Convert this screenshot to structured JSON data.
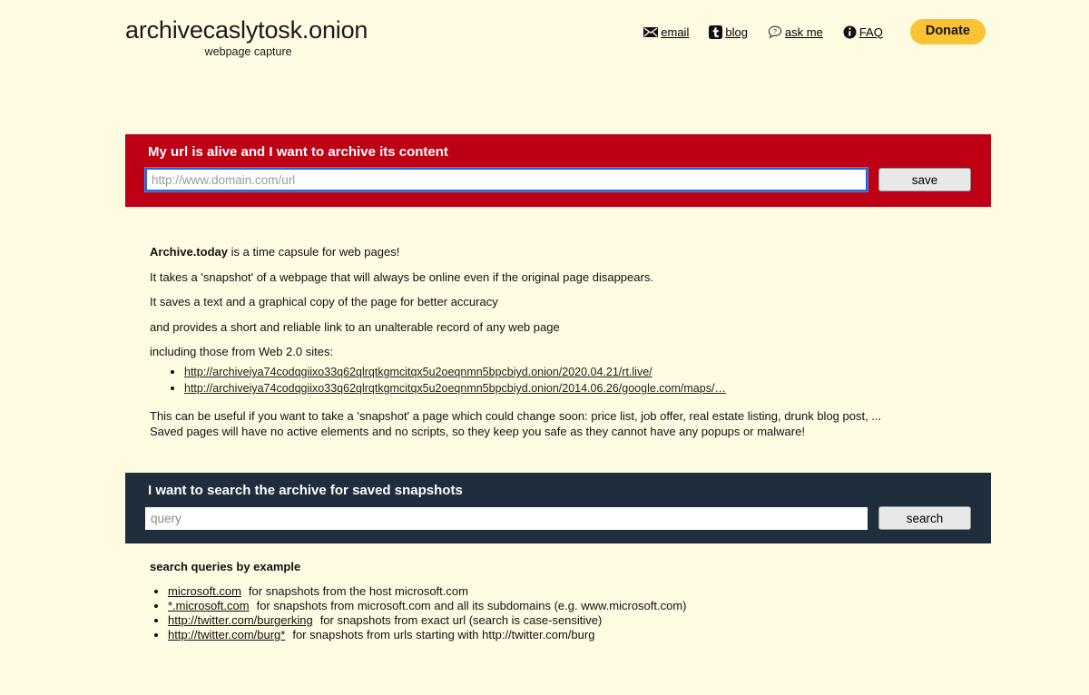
{
  "header": {
    "title": "archivecaslytosk.onion",
    "subtitle": "webpage capture",
    "nav": [
      {
        "id": "email",
        "label": "email",
        "icon": "envelope-icon"
      },
      {
        "id": "blog",
        "label": "blog",
        "icon": "tumblr-icon"
      },
      {
        "id": "ask-me",
        "label": "ask me",
        "icon": "question-bubble-icon"
      },
      {
        "id": "faq",
        "label": "FAQ",
        "icon": "info-circle-icon"
      }
    ],
    "donate_label": "Donate"
  },
  "archive_panel": {
    "title": "My url is alive and I want to archive its content",
    "input_placeholder": "http://www.domain.com/url",
    "input_value": "",
    "button_label": "save",
    "background": "#BE0015"
  },
  "intro": {
    "brand": "Archive.today",
    "line1_rest": " is a time capsule for web pages!",
    "line2": "It takes a 'snapshot' of a webpage that will always be online even if the original page disappears.",
    "line3": "It saves a text and a graphical copy of the page for better accuracy",
    "line4": "and provides a short and reliable link to an unalterable record of any web page",
    "line5": "including those from Web 2.0 sites:",
    "examples": [
      "http://archiveiya74codqgiixo33q62qlrqtkgmcitqx5u2oeqnmn5bpcbiyd.onion/2020.04.21/rt.live/",
      "http://archiveiya74codqgiixo33q62qlrqtkgmcitqx5u2oeqnmn5bpcbiyd.onion/2014.06.26/google.com/maps/…"
    ]
  },
  "closing": {
    "line1": "This can be useful if you want to take a 'snapshot' a page which could change soon: price list, job offer, real estate listing, drunk blog post, ...",
    "line2": "Saved pages will have no active elements and no scripts, so they keep you safe as they cannot have any popups or malware!"
  },
  "search_panel": {
    "title": "I want to search the archive for saved snapshots",
    "input_placeholder": "query",
    "input_value": "",
    "button_label": "search",
    "background": "#1F2D3D"
  },
  "search_examples": {
    "title": "search queries by example",
    "items": [
      {
        "query": "microsoft.com",
        "description": "for snapshots from the host microsoft.com"
      },
      {
        "query": "*.microsoft.com",
        "description": "for snapshots from microsoft.com and all its subdomains (e.g. www.microsoft.com)"
      },
      {
        "query": "http://twitter.com/burgerking",
        "description": "for snapshots from exact url (search is case-sensitive)"
      },
      {
        "query": "http://twitter.com/burg*",
        "description": "for snapshots from urls starting with http://twitter.com/burg"
      }
    ]
  },
  "theme": {
    "page_background": "#FFFBE3",
    "accent_red": "#BE0015",
    "accent_navy": "#1F2D3D",
    "donate_yellow": "#FBC334",
    "focus_blue": "#2763D0"
  }
}
